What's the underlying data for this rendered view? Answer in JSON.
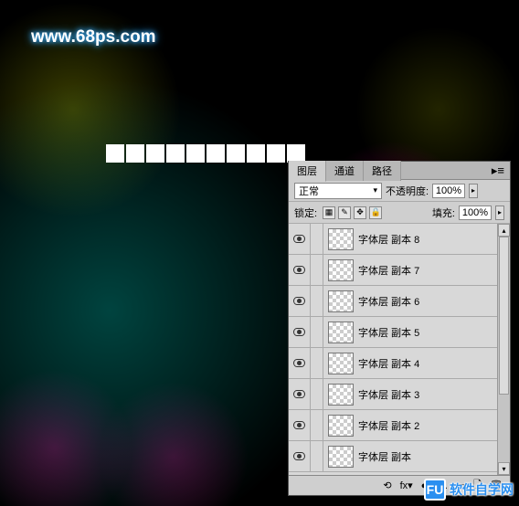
{
  "watermark": "www.68ps.com",
  "square_count": 10,
  "panel": {
    "tabs": [
      "图层",
      "通道",
      "路径"
    ],
    "active_tab": 0,
    "blend_mode": "正常",
    "opacity_label": "不透明度:",
    "opacity_value": "100%",
    "lock_label": "锁定:",
    "fill_label": "填充:",
    "fill_value": "100%",
    "lock_icons": [
      "▦",
      "✎",
      "✥",
      "🔒"
    ],
    "layers": [
      {
        "name": "字体层 副本 8"
      },
      {
        "name": "字体层 副本 7"
      },
      {
        "name": "字体层 副本 6"
      },
      {
        "name": "字体层 副本 5"
      },
      {
        "name": "字体层 副本 4"
      },
      {
        "name": "字体层 副本 3"
      },
      {
        "name": "字体层 副本 2"
      },
      {
        "name": "字体层 副本"
      }
    ],
    "footer_icons": [
      "⟲",
      "fx▾",
      "◐",
      "◧.",
      "▭",
      "🗋",
      "🗑"
    ]
  },
  "brand": {
    "logo": "FU",
    "text": "软件自学网"
  }
}
